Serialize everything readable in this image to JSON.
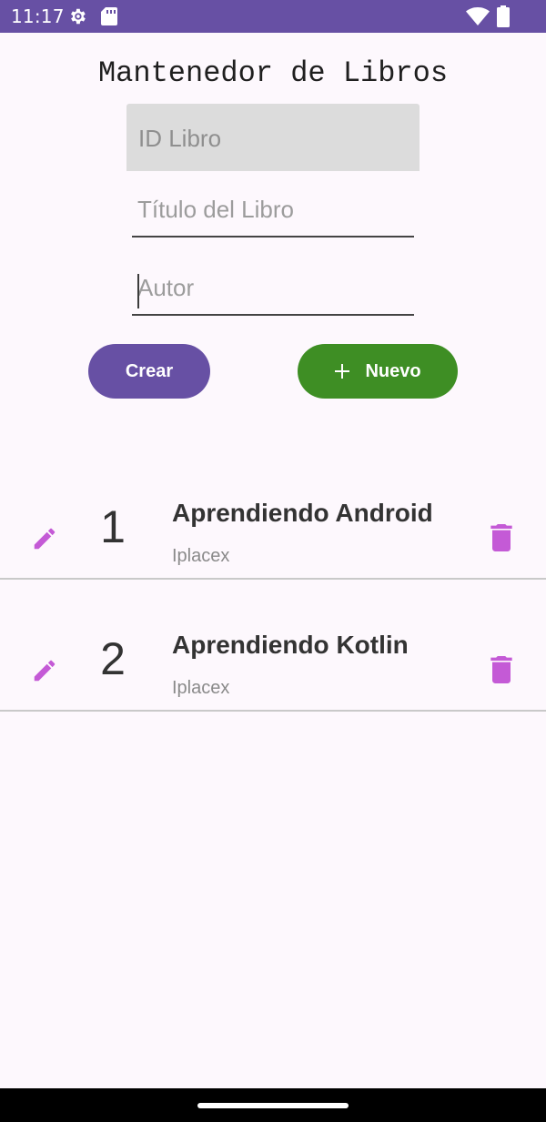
{
  "status_bar": {
    "time": "11:17",
    "icons": [
      "gear-icon",
      "sd-card-icon",
      "wifi-icon",
      "battery-icon"
    ],
    "background": "#6750a4"
  },
  "app": {
    "title": "Mantenedor de Libros"
  },
  "form": {
    "id_placeholder": "ID Libro",
    "title_placeholder": "Título del Libro",
    "author_placeholder": "Autor"
  },
  "buttons": {
    "create_label": "Crear",
    "create_color": "#6750a4",
    "new_label": "Nuevo",
    "new_color": "#3e8e24",
    "new_icon": "plus-icon"
  },
  "books": [
    {
      "id": "1",
      "title": "Aprendiendo Android",
      "author": "Iplacex"
    },
    {
      "id": "2",
      "title": "Aprendiendo Kotlin",
      "author": "Iplacex"
    }
  ],
  "row_icons": {
    "edit": "pencil-icon",
    "delete": "trash-icon",
    "color": "#c45ad6"
  }
}
